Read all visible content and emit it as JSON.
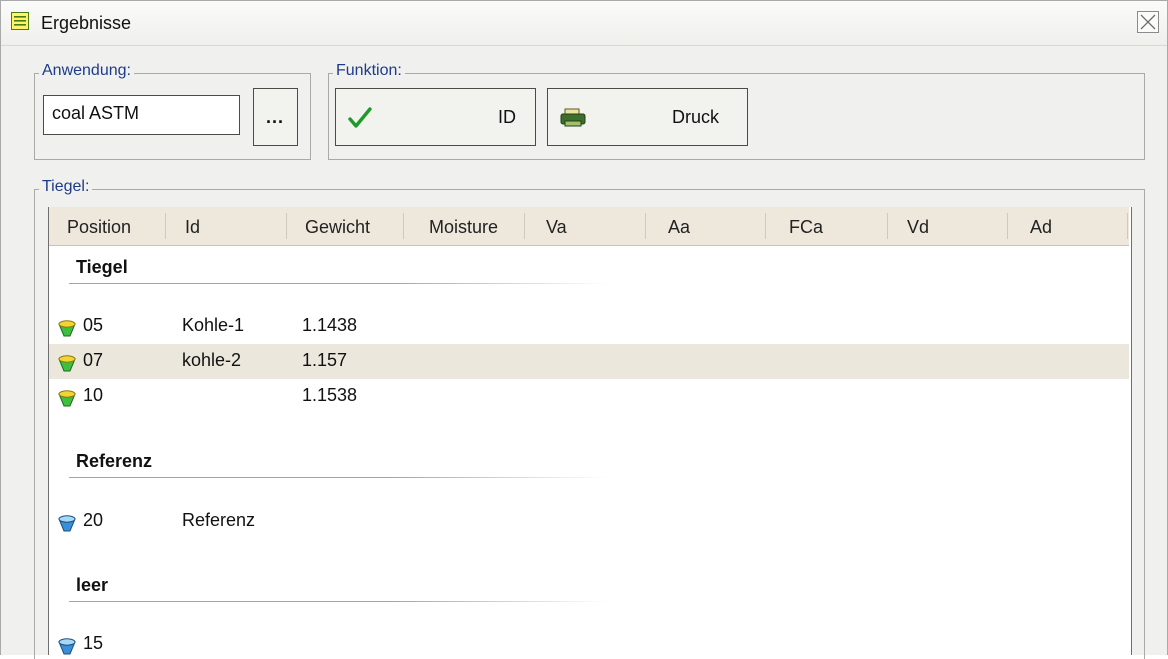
{
  "window": {
    "title": "Ergebnisse"
  },
  "anwendung": {
    "label": "Anwendung:",
    "value": "coal ASTM",
    "browse_label": "..."
  },
  "funktion": {
    "label": "Funktion:",
    "id_label": "ID",
    "print_label": "Druck"
  },
  "tiegel": {
    "label": "Tiegel:",
    "columns": [
      "Position",
      "Id",
      "Gewicht",
      "Moisture",
      "Va",
      "Aa",
      "FCa",
      "Vd",
      "Ad"
    ],
    "groups": [
      {
        "name": "Tiegel",
        "rows": [
          {
            "position": "05",
            "id": "Kohle-1",
            "gewicht": "1.1438",
            "status": "green",
            "selected": false
          },
          {
            "position": "07",
            "id": "kohle-2",
            "gewicht": "1.157",
            "status": "green",
            "selected": true
          },
          {
            "position": "10",
            "id": "",
            "gewicht": "1.1538",
            "status": "green",
            "selected": false
          }
        ]
      },
      {
        "name": "Referenz",
        "rows": [
          {
            "position": "20",
            "id": "Referenz",
            "gewicht": "",
            "status": "blue",
            "selected": false
          }
        ]
      },
      {
        "name": "leer",
        "rows": [
          {
            "position": "15",
            "id": "",
            "gewicht": "",
            "status": "blue",
            "selected": false
          }
        ]
      }
    ]
  },
  "colors": {
    "label_blue": "#1d3b8a",
    "header_bg": "#ede8db",
    "selected_row": "#ece7dc",
    "status_green": "#3fbf3f",
    "status_yellow": "#f2d530",
    "status_blue": "#3a8fd8"
  },
  "icons": {
    "title": "list-window-icon",
    "close": "close-x-icon",
    "id_button": "green-checkmark-icon",
    "print_button": "printer-icon",
    "crucible_green": "crucible-green-icon",
    "crucible_blue": "crucible-blue-icon"
  }
}
